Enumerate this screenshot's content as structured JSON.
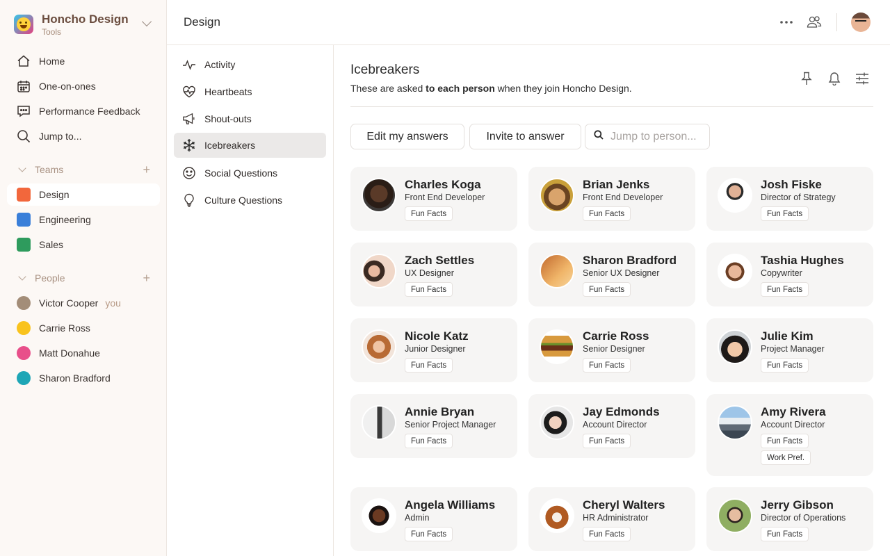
{
  "app": {
    "name": "Honcho Design",
    "subtitle": "Tools"
  },
  "sidebar": {
    "nav": [
      {
        "label": "Home",
        "icon": "home-icon"
      },
      {
        "label": "One-on-ones",
        "icon": "calendar-icon"
      },
      {
        "label": "Performance Feedback",
        "icon": "chat-icon"
      },
      {
        "label": "Jump to...",
        "icon": "search-icon"
      }
    ],
    "teams_heading": "Teams",
    "teams": [
      {
        "label": "Design",
        "color": "#f2673c"
      },
      {
        "label": "Engineering",
        "color": "#3a7fd9"
      },
      {
        "label": "Sales",
        "color": "#2e9b5d"
      }
    ],
    "people_heading": "People",
    "people": [
      {
        "label": "Victor Cooper",
        "color": "#a38d78",
        "suffix": "you"
      },
      {
        "label": "Carrie Ross",
        "color": "#f9c31d"
      },
      {
        "label": "Matt Donahue",
        "color": "#e84f8a"
      },
      {
        "label": "Sharon Bradford",
        "color": "#1ea6b6"
      }
    ]
  },
  "header": {
    "title": "Design"
  },
  "subnav": [
    {
      "label": "Activity",
      "icon": "activity-icon"
    },
    {
      "label": "Heartbeats",
      "icon": "heartbeat-icon"
    },
    {
      "label": "Shout-outs",
      "icon": "megaphone-icon"
    },
    {
      "label": "Icebreakers",
      "icon": "snowflake-icon"
    },
    {
      "label": "Social Questions",
      "icon": "smiley-icon"
    },
    {
      "label": "Culture Questions",
      "icon": "lightbulb-icon"
    }
  ],
  "main": {
    "title": "Icebreakers",
    "desc_prefix": "These are asked ",
    "desc_bold": "to each person",
    "desc_suffix": " when they join Honcho Design.",
    "edit_button": "Edit my answers",
    "invite_button": "Invite to answer",
    "search_placeholder": "Jump to person..."
  },
  "people_cards": [
    {
      "name": "Charles Koga",
      "role": "Front End Developer",
      "tags": [
        "Fun Facts"
      ]
    },
    {
      "name": "Brian Jenks",
      "role": "Front End Developer",
      "tags": [
        "Fun Facts"
      ]
    },
    {
      "name": "Josh Fiske",
      "role": "Director of Strategy",
      "tags": [
        "Fun Facts"
      ]
    },
    {
      "name": "Zach Settles",
      "role": "UX Designer",
      "tags": [
        "Fun Facts"
      ]
    },
    {
      "name": "Sharon Bradford",
      "role": "Senior UX Designer",
      "tags": [
        "Fun Facts"
      ]
    },
    {
      "name": "Tashia Hughes",
      "role": "Copywriter",
      "tags": [
        "Fun Facts"
      ]
    },
    {
      "name": "Nicole Katz",
      "role": "Junior Designer",
      "tags": [
        "Fun Facts"
      ]
    },
    {
      "name": "Carrie Ross",
      "role": "Senior Designer",
      "tags": [
        "Fun Facts"
      ]
    },
    {
      "name": "Julie Kim",
      "role": "Project Manager",
      "tags": [
        "Fun Facts"
      ]
    },
    {
      "name": "Annie Bryan",
      "role": "Senior Project Manager",
      "tags": [
        "Fun Facts"
      ]
    },
    {
      "name": "Jay Edmonds",
      "role": "Account Director",
      "tags": [
        "Fun Facts"
      ]
    },
    {
      "name": "Amy Rivera",
      "role": "Account Director",
      "tags": [
        "Fun Facts",
        "Work Pref."
      ]
    },
    {
      "name": "Angela Williams",
      "role": "Admin",
      "tags": [
        "Fun Facts"
      ]
    },
    {
      "name": "Cheryl Walters",
      "role": "HR Administrator",
      "tags": [
        "Fun Facts"
      ]
    },
    {
      "name": "Jerry Gibson",
      "role": "Director of Operations",
      "tags": [
        "Fun Facts"
      ]
    }
  ]
}
